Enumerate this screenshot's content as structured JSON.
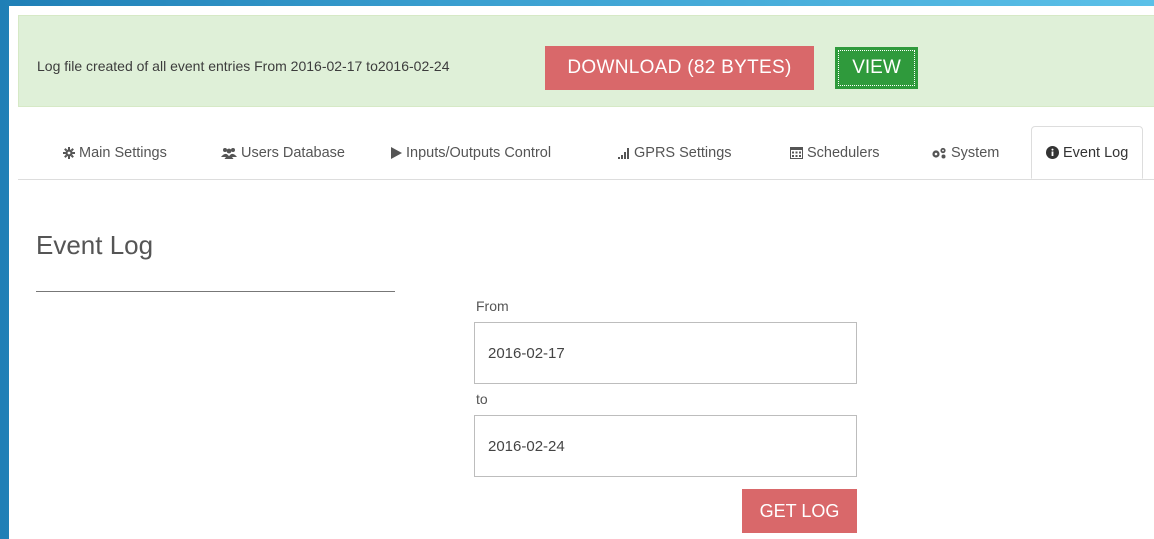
{
  "alert": {
    "message": "Log file created of all event entries From 2016-02-17 to2016-02-24",
    "download_label": "DOWNLOAD (82 BYTES)",
    "view_label": "VIEW"
  },
  "tabs": [
    {
      "label": "Main Settings",
      "icon": "gear-icon"
    },
    {
      "label": "Users Database",
      "icon": "users-icon"
    },
    {
      "label": "Inputs/Outputs Control",
      "icon": "play-icon"
    },
    {
      "label": "GPRS Settings",
      "icon": "signal-icon"
    },
    {
      "label": "Schedulers",
      "icon": "calendar-icon"
    },
    {
      "label": "System",
      "icon": "gears-icon"
    },
    {
      "label": "Event Log",
      "icon": "info-circle-icon",
      "active": true
    }
  ],
  "main": {
    "title": "Event Log",
    "from_label": "From",
    "from_value": "2016-02-17",
    "to_label": "to",
    "to_value": "2016-02-24",
    "get_log_label": "GET LOG"
  },
  "colors": {
    "alert_bg": "#dff0d8",
    "danger": "#d9686a",
    "success": "#2f9a3c"
  }
}
